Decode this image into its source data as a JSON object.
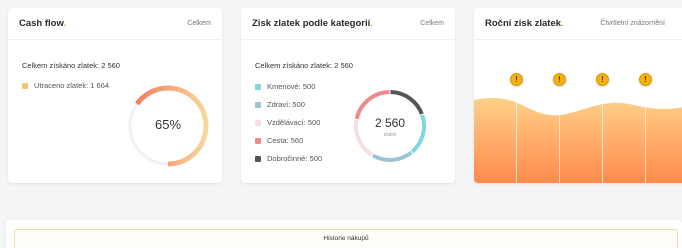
{
  "cashflow": {
    "title": "Cash flow",
    "title_dot": ".",
    "filter": "Celkem",
    "total": "Celkem získáno zlatek: 2 560",
    "spent": {
      "label": "Utraceno zlatek: 1 664",
      "color": "#f5c36b"
    },
    "percent_label": "65%",
    "percent": 65
  },
  "categories": {
    "title": "Zisk zlatek podle kategorií",
    "title_dot": ".",
    "filter": "Celkem",
    "total": "Celkem získáno zlatek: 2 560",
    "items": [
      {
        "label": "Kmenové: 500",
        "color": "#7fd8dc",
        "value": 500
      },
      {
        "label": "Zdraví: 500",
        "color": "#9cc5d4",
        "value": 500
      },
      {
        "label": "Vzdělávací: 500",
        "color": "#f6dede",
        "value": 500
      },
      {
        "label": "Cesta: 560",
        "color": "#ef8a8a",
        "value": 560
      },
      {
        "label": "Dobročinné: 500",
        "color": "#555555",
        "value": 500
      }
    ],
    "center_value": "2 560",
    "center_unit": "zlatek"
  },
  "annual": {
    "title": "Roční zisk zlatek",
    "title_dot": ".",
    "filter": "Čtvrtletní znázornění",
    "markers": [
      "!",
      "!",
      "!",
      "!"
    ],
    "gradient_top": "#ffd089",
    "gradient_bottom": "#ff8a4c"
  },
  "history": {
    "button_label": "Historie nákupů"
  }
}
